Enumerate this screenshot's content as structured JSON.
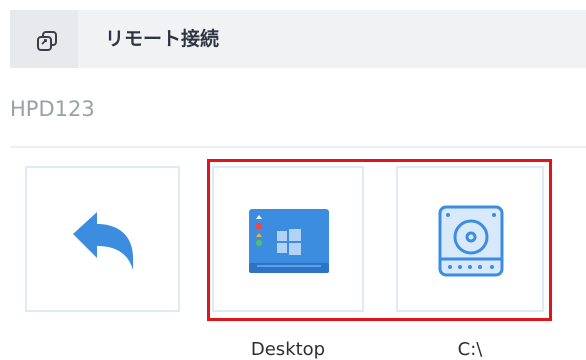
{
  "header": {
    "title": "リモート接続",
    "icon": "remote-connection-icon"
  },
  "machine": {
    "name": "HPD123"
  },
  "tiles": [
    {
      "label": "",
      "icon": "back-arrow-icon"
    },
    {
      "label": "Desktop",
      "icon": "desktop-window-icon"
    },
    {
      "label": "C:\\",
      "icon": "hard-drive-icon"
    }
  ],
  "colors": {
    "accent": "#3c8ce0",
    "selection": "#e0141b"
  }
}
